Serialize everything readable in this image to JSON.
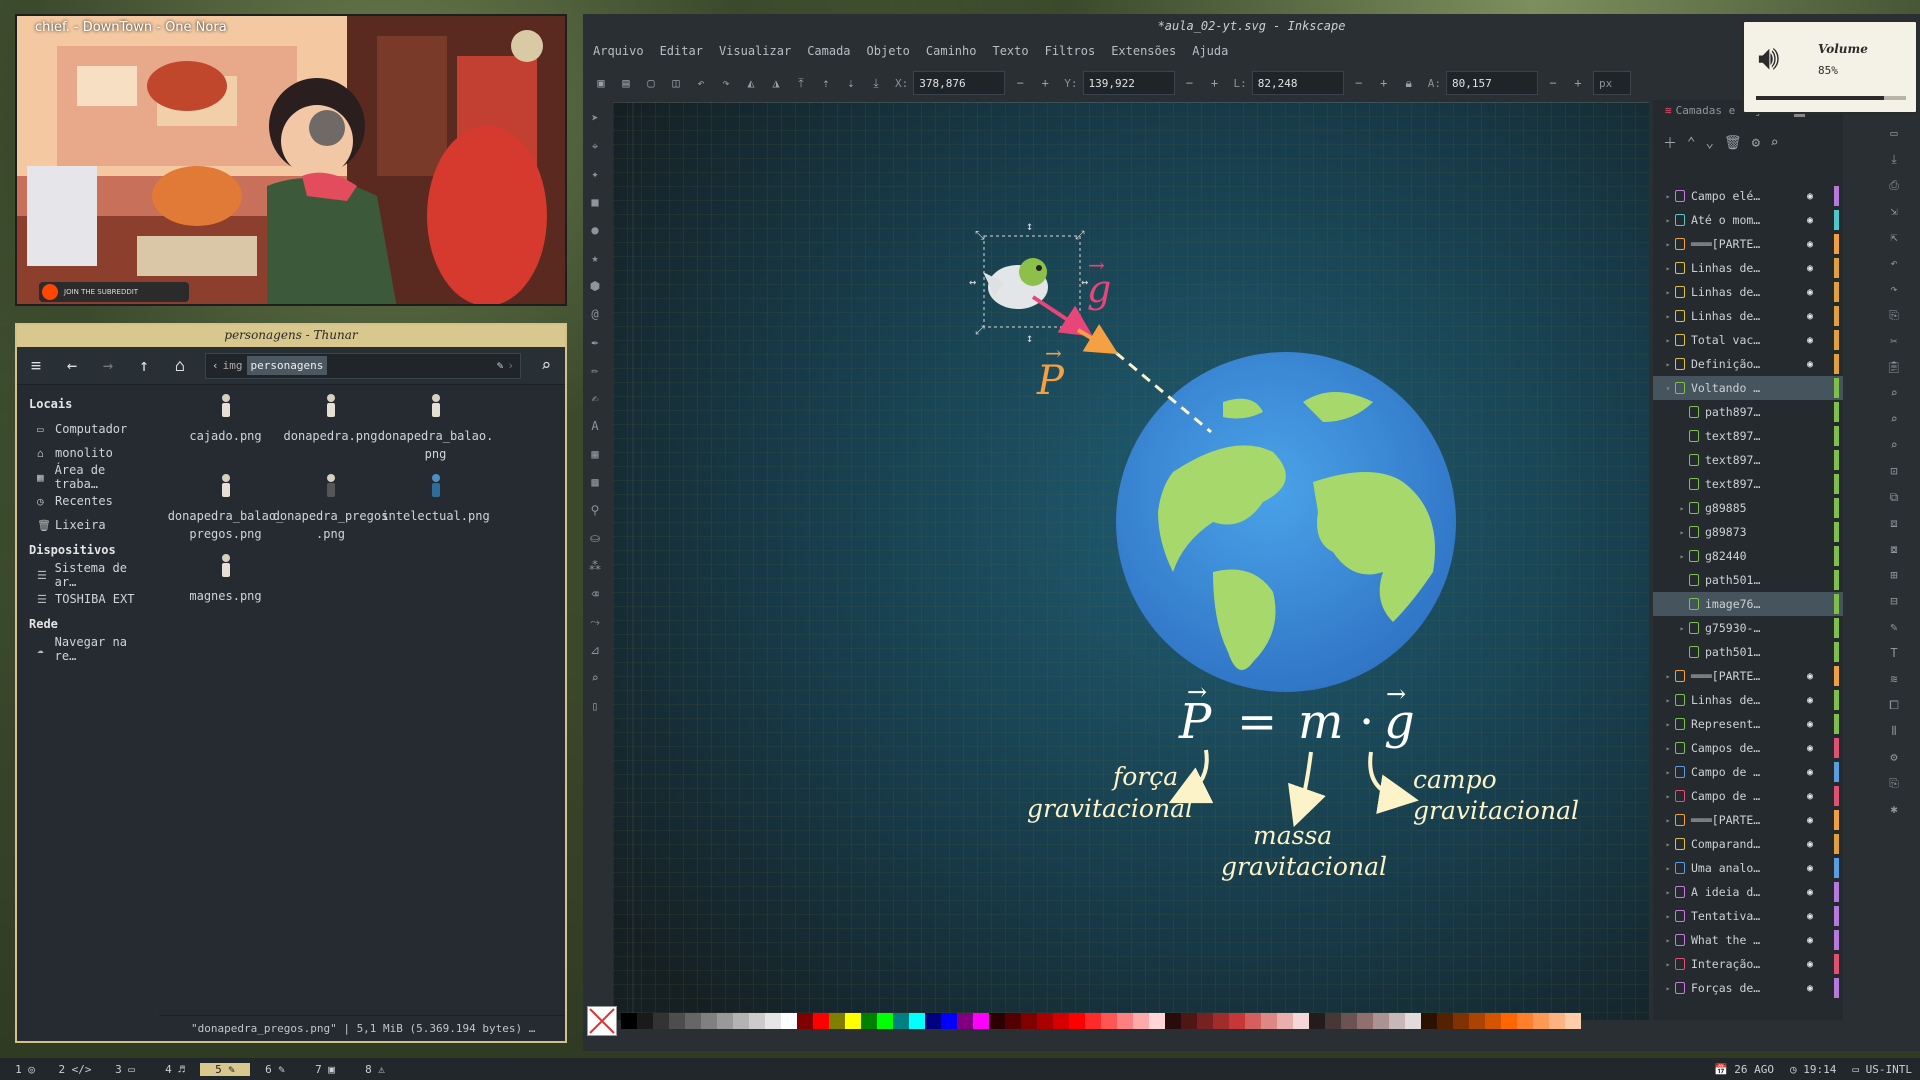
{
  "video": {
    "title": "chief. - DownTown - One Nora",
    "badge_text": "JOIN THE SUBREDDIT"
  },
  "thunar": {
    "title": "personagens - Thunar",
    "path_parent": "img",
    "path_current": "personagens",
    "sidebar": [
      {
        "header": "Locais"
      },
      {
        "icon": "computer-icon",
        "label": "Computador"
      },
      {
        "icon": "home-icon",
        "label": "monolito"
      },
      {
        "icon": "desktop-icon",
        "label": "Área de traba…"
      },
      {
        "icon": "recent-icon",
        "label": "Recentes"
      },
      {
        "icon": "trash-icon",
        "label": "Lixeira"
      },
      {
        "header": "Dispositivos"
      },
      {
        "icon": "drive-icon",
        "label": "Sistema de ar…"
      },
      {
        "icon": "drive-icon",
        "label": "TOSHIBA EXT"
      },
      {
        "header": "Rede"
      },
      {
        "icon": "network-icon",
        "label": "Navegar na re…"
      }
    ],
    "files": [
      {
        "line1": "cajado.png",
        "line2": ""
      },
      {
        "line1": "donapedra.png",
        "line2": ""
      },
      {
        "line1": "donapedra_balao.",
        "line2": "png"
      },
      {
        "line1": "donapedra_balao_",
        "line2": "pregos.png"
      },
      {
        "line1": "donapedra_pregos",
        "line2": ".png"
      },
      {
        "line1": "intelectual.png",
        "line2": ""
      },
      {
        "line1": "magnes.png",
        "line2": ""
      }
    ],
    "status": "\"donapedra_pregos.png\"  |  5,1 MiB (5.369.194 bytes) …"
  },
  "inkscape": {
    "title": "*aula_02-yt.svg - Inkscape",
    "menu": [
      "Arquivo",
      "Editar",
      "Visualizar",
      "Camada",
      "Objeto",
      "Caminho",
      "Texto",
      "Filtros",
      "Extensões",
      "Ajuda"
    ],
    "x_label": "X:",
    "x_value": "378,876",
    "y_label": "Y:",
    "y_value": "139,922",
    "w_label": "L:",
    "w_value": "82,248",
    "h_label": "A:",
    "h_value": "80,157",
    "unit": "px",
    "panel_tab": "Camadas e Objetos",
    "layers": [
      {
        "label": "Campo elé…",
        "exp": "▸",
        "indent": 0,
        "color": "#c47adf",
        "stripe": "#b57adb",
        "eye": true
      },
      {
        "label": "Até o mom…",
        "exp": "▸",
        "indent": 0,
        "color": "#4ec9c9",
        "stripe": "#4ec9c9",
        "eye": true
      },
      {
        "label": "═══[PARTE…",
        "exp": "▸",
        "indent": 0,
        "color": "#f0a040",
        "stripe": "#f0a040",
        "eye": true
      },
      {
        "label": "Linhas de…",
        "exp": "▸",
        "indent": 0,
        "color": "#e0c040",
        "stripe": "#e0a040",
        "eye": true
      },
      {
        "label": "Linhas de…",
        "exp": "▸",
        "indent": 0,
        "color": "#e0c040",
        "stripe": "#e0a040",
        "eye": true
      },
      {
        "label": "Linhas de…",
        "exp": "▸",
        "indent": 0,
        "color": "#e0c040",
        "stripe": "#e0a040",
        "eye": true
      },
      {
        "label": "Total vac…",
        "exp": "▸",
        "indent": 0,
        "color": "#e0c040",
        "stripe": "#e0a040",
        "eye": true
      },
      {
        "label": "Definição…",
        "exp": "▸",
        "indent": 0,
        "color": "#e0c040",
        "stripe": "#e0a040",
        "eye": true
      },
      {
        "label": "Voltando …",
        "exp": "▾",
        "indent": 0,
        "color": "#7cc04a",
        "stripe": "#7cc04a",
        "eye": false,
        "sel": true
      },
      {
        "label": "path897…",
        "exp": "",
        "indent": 1,
        "color": "#7cc04a",
        "stripe": "#7cc04a",
        "eye": false
      },
      {
        "label": "text897…",
        "exp": "",
        "indent": 1,
        "color": "#7cc04a",
        "stripe": "#7cc04a",
        "eye": false
      },
      {
        "label": "text897…",
        "exp": "",
        "indent": 1,
        "color": "#7cc04a",
        "stripe": "#7cc04a",
        "eye": false
      },
      {
        "label": "text897…",
        "exp": "",
        "indent": 1,
        "color": "#7cc04a",
        "stripe": "#7cc04a",
        "eye": false
      },
      {
        "label": "g89885",
        "exp": "▸",
        "indent": 1,
        "color": "#7cc04a",
        "stripe": "#7cc04a",
        "eye": false
      },
      {
        "label": "g89873",
        "exp": "▸",
        "indent": 1,
        "color": "#7cc04a",
        "stripe": "#7cc04a",
        "eye": false
      },
      {
        "label": "g82440",
        "exp": "▸",
        "indent": 1,
        "color": "#7cc04a",
        "stripe": "#7cc04a",
        "eye": false
      },
      {
        "label": "path501…",
        "exp": "",
        "indent": 1,
        "color": "#7cc04a",
        "stripe": "#7cc04a",
        "eye": false
      },
      {
        "label": "image76…",
        "exp": "",
        "indent": 1,
        "color": "#7cc04a",
        "stripe": "#7cc04a",
        "eye": false,
        "sel": true
      },
      {
        "label": "g75930-…",
        "exp": "▸",
        "indent": 1,
        "color": "#7cc04a",
        "stripe": "#7cc04a",
        "eye": false
      },
      {
        "label": "path501…",
        "exp": "",
        "indent": 1,
        "color": "#7cc04a",
        "stripe": "#7cc04a",
        "eye": false
      },
      {
        "label": "═══[PARTE…",
        "exp": "▸",
        "indent": 0,
        "color": "#f0a040",
        "stripe": "#f0a040",
        "eye": true
      },
      {
        "label": "Linhas de…",
        "exp": "▸",
        "indent": 0,
        "color": "#7cc04a",
        "stripe": "#7cc04a",
        "eye": true
      },
      {
        "label": "Represent…",
        "exp": "▸",
        "indent": 0,
        "color": "#7cc04a",
        "stripe": "#7cc04a",
        "eye": true
      },
      {
        "label": "Campos de…",
        "exp": "▸",
        "indent": 0,
        "color": "#7cc04a",
        "stripe": "#e05070",
        "eye": true
      },
      {
        "label": "Campo de …",
        "exp": "▸",
        "indent": 0,
        "color": "#5a9ee0",
        "stripe": "#5a9ee0",
        "eye": true
      },
      {
        "label": "Campo de …",
        "exp": "▸",
        "indent": 0,
        "color": "#e05070",
        "stripe": "#e05070",
        "eye": true
      },
      {
        "label": "═══[PARTE…",
        "exp": "▸",
        "indent": 0,
        "color": "#f0a040",
        "stripe": "#f0a040",
        "eye": true
      },
      {
        "label": "Comparand…",
        "exp": "▸",
        "indent": 0,
        "color": "#e0c040",
        "stripe": "#e0a040",
        "eye": true
      },
      {
        "label": "Uma analo…",
        "exp": "▸",
        "indent": 0,
        "color": "#5a9ee0",
        "stripe": "#5a9ee0",
        "eye": true
      },
      {
        "label": "A ideia d…",
        "exp": "▸",
        "indent": 0,
        "color": "#c47adf",
        "stripe": "#b57adb",
        "eye": true
      },
      {
        "label": "Tentativa…",
        "exp": "▸",
        "indent": 0,
        "color": "#c47adf",
        "stripe": "#b57adb",
        "eye": true
      },
      {
        "label": "What the …",
        "exp": "▸",
        "indent": 0,
        "color": "#c47adf",
        "stripe": "#b57adb",
        "eye": true
      },
      {
        "label": "Interação…",
        "exp": "▸",
        "indent": 0,
        "color": "#e05070",
        "stripe": "#e05070",
        "eye": true
      },
      {
        "label": "Forças de…",
        "exp": "▸",
        "indent": 0,
        "color": "#c47adf",
        "stripe": "#b57adb",
        "eye": true
      }
    ],
    "canvas": {
      "vec_g": "g",
      "vec_p": "P",
      "equation_left": "P",
      "equation_eq": "=",
      "equation_m": "m",
      "equation_dot": "·",
      "equation_g": "g",
      "label_forca_1": "força",
      "label_forca_2": "gravitacional",
      "label_massa_1": "massa",
      "label_massa_2": "gravitacional",
      "label_campo_1": "campo",
      "label_campo_2": "gravitacional"
    }
  },
  "volume": {
    "label": "Volume",
    "percent_text": "85%",
    "level": 0.85
  },
  "taskbar": {
    "workspaces": [
      {
        "label": "1 ◎",
        "active": false
      },
      {
        "label": "2 </>",
        "active": false
      },
      {
        "label": "3 ▭",
        "active": false
      },
      {
        "label": "4 ♬",
        "active": false
      },
      {
        "label": "5 ✎",
        "active": true
      },
      {
        "label": "6 ✎",
        "active": false
      },
      {
        "label": "7 ▣",
        "active": false
      },
      {
        "label": "8 ⚠",
        "active": false
      }
    ],
    "date": "📅 26 AGO",
    "time": "◷ 19:14",
    "keyboard": "▭ US-INTL"
  },
  "palette": [
    "#000000",
    "#1a1a1a",
    "#333333",
    "#4d4d4d",
    "#666666",
    "#808080",
    "#999999",
    "#b3b3b3",
    "#cccccc",
    "#e6e6e6",
    "#ffffff",
    "#800000",
    "#ff0000",
    "#808000",
    "#ffff00",
    "#008000",
    "#00ff00",
    "#008080",
    "#00ffff",
    "#000080",
    "#0000ff",
    "#800080",
    "#ff00ff",
    "#2b0000",
    "#550000",
    "#800000",
    "#aa0000",
    "#d40000",
    "#ff0000",
    "#ff2a2a",
    "#ff5555",
    "#ff8080",
    "#ffaaaa",
    "#ffd5d5",
    "#280b0b",
    "#501616",
    "#782121",
    "#a02c2c",
    "#c83737",
    "#d35f5f",
    "#de8787",
    "#e9afaf",
    "#f4d7d7",
    "#241c1c",
    "#483737",
    "#6c5353",
    "#916f6f",
    "#ac9393",
    "#c8b7b7",
    "#e3dbdb",
    "#2b1100",
    "#552200",
    "#803300",
    "#aa4400",
    "#d45500",
    "#ff6600",
    "#ff7f2a",
    "#ff9955",
    "#ffb380",
    "#ffccaa"
  ]
}
